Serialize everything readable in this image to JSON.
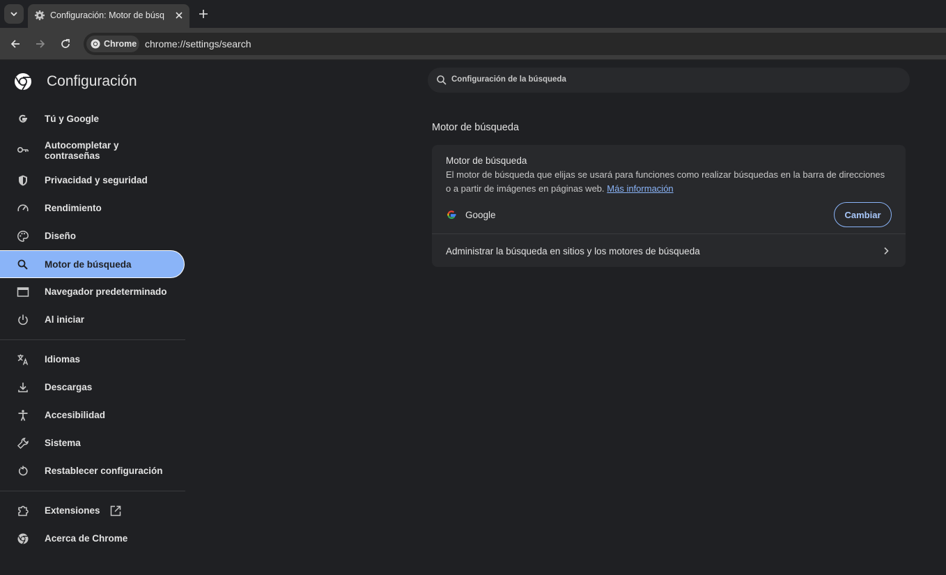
{
  "browser": {
    "tab_title": "Configuración: Motor de búsq",
    "chip_label": "Chrome",
    "url": "chrome://settings/search"
  },
  "settings": {
    "title": "Configuración",
    "search_placeholder": "Configuración de la búsqueda"
  },
  "sidebar": {
    "items": [
      {
        "label": "Tú y Google",
        "icon": "google-g-icon"
      },
      {
        "label": "Autocompletar y\ncontraseñas",
        "icon": "key-icon"
      },
      {
        "label": "Privacidad y seguridad",
        "icon": "shield-icon"
      },
      {
        "label": "Rendimiento",
        "icon": "speedometer-icon"
      },
      {
        "label": "Diseño",
        "icon": "palette-icon"
      },
      {
        "label": "Motor de búsqueda",
        "icon": "search-icon",
        "active": true
      },
      {
        "label": "Navegador predeterminado",
        "icon": "browser-window-icon"
      },
      {
        "label": "Al iniciar",
        "icon": "power-icon"
      },
      {
        "label": "Idiomas",
        "icon": "translate-icon"
      },
      {
        "label": "Descargas",
        "icon": "download-icon"
      },
      {
        "label": "Accesibilidad",
        "icon": "accessibility-icon"
      },
      {
        "label": "Sistema",
        "icon": "wrench-icon"
      },
      {
        "label": "Restablecer configuración",
        "icon": "reset-icon"
      },
      {
        "label": "Extensiones",
        "icon": "puzzle-icon"
      },
      {
        "label": "Acerca de Chrome",
        "icon": "chrome-icon"
      }
    ]
  },
  "main": {
    "section_title": "Motor de búsqueda",
    "card": {
      "title": "Motor de búsqueda",
      "description": "El motor de búsqueda que elijas se usará para funciones como realizar búsquedas en la barra de direcciones o a partir de imágenes en páginas web.",
      "link": "Más información",
      "engine": "Google",
      "change_button": "Cambiar",
      "manage_label": "Administrar la búsqueda en sitios y los motores de búsqueda"
    }
  },
  "colors": {
    "background": "#1f2023",
    "card": "#28292c",
    "accent": "#8ab4f8",
    "toolbar": "#3c3c3c"
  }
}
